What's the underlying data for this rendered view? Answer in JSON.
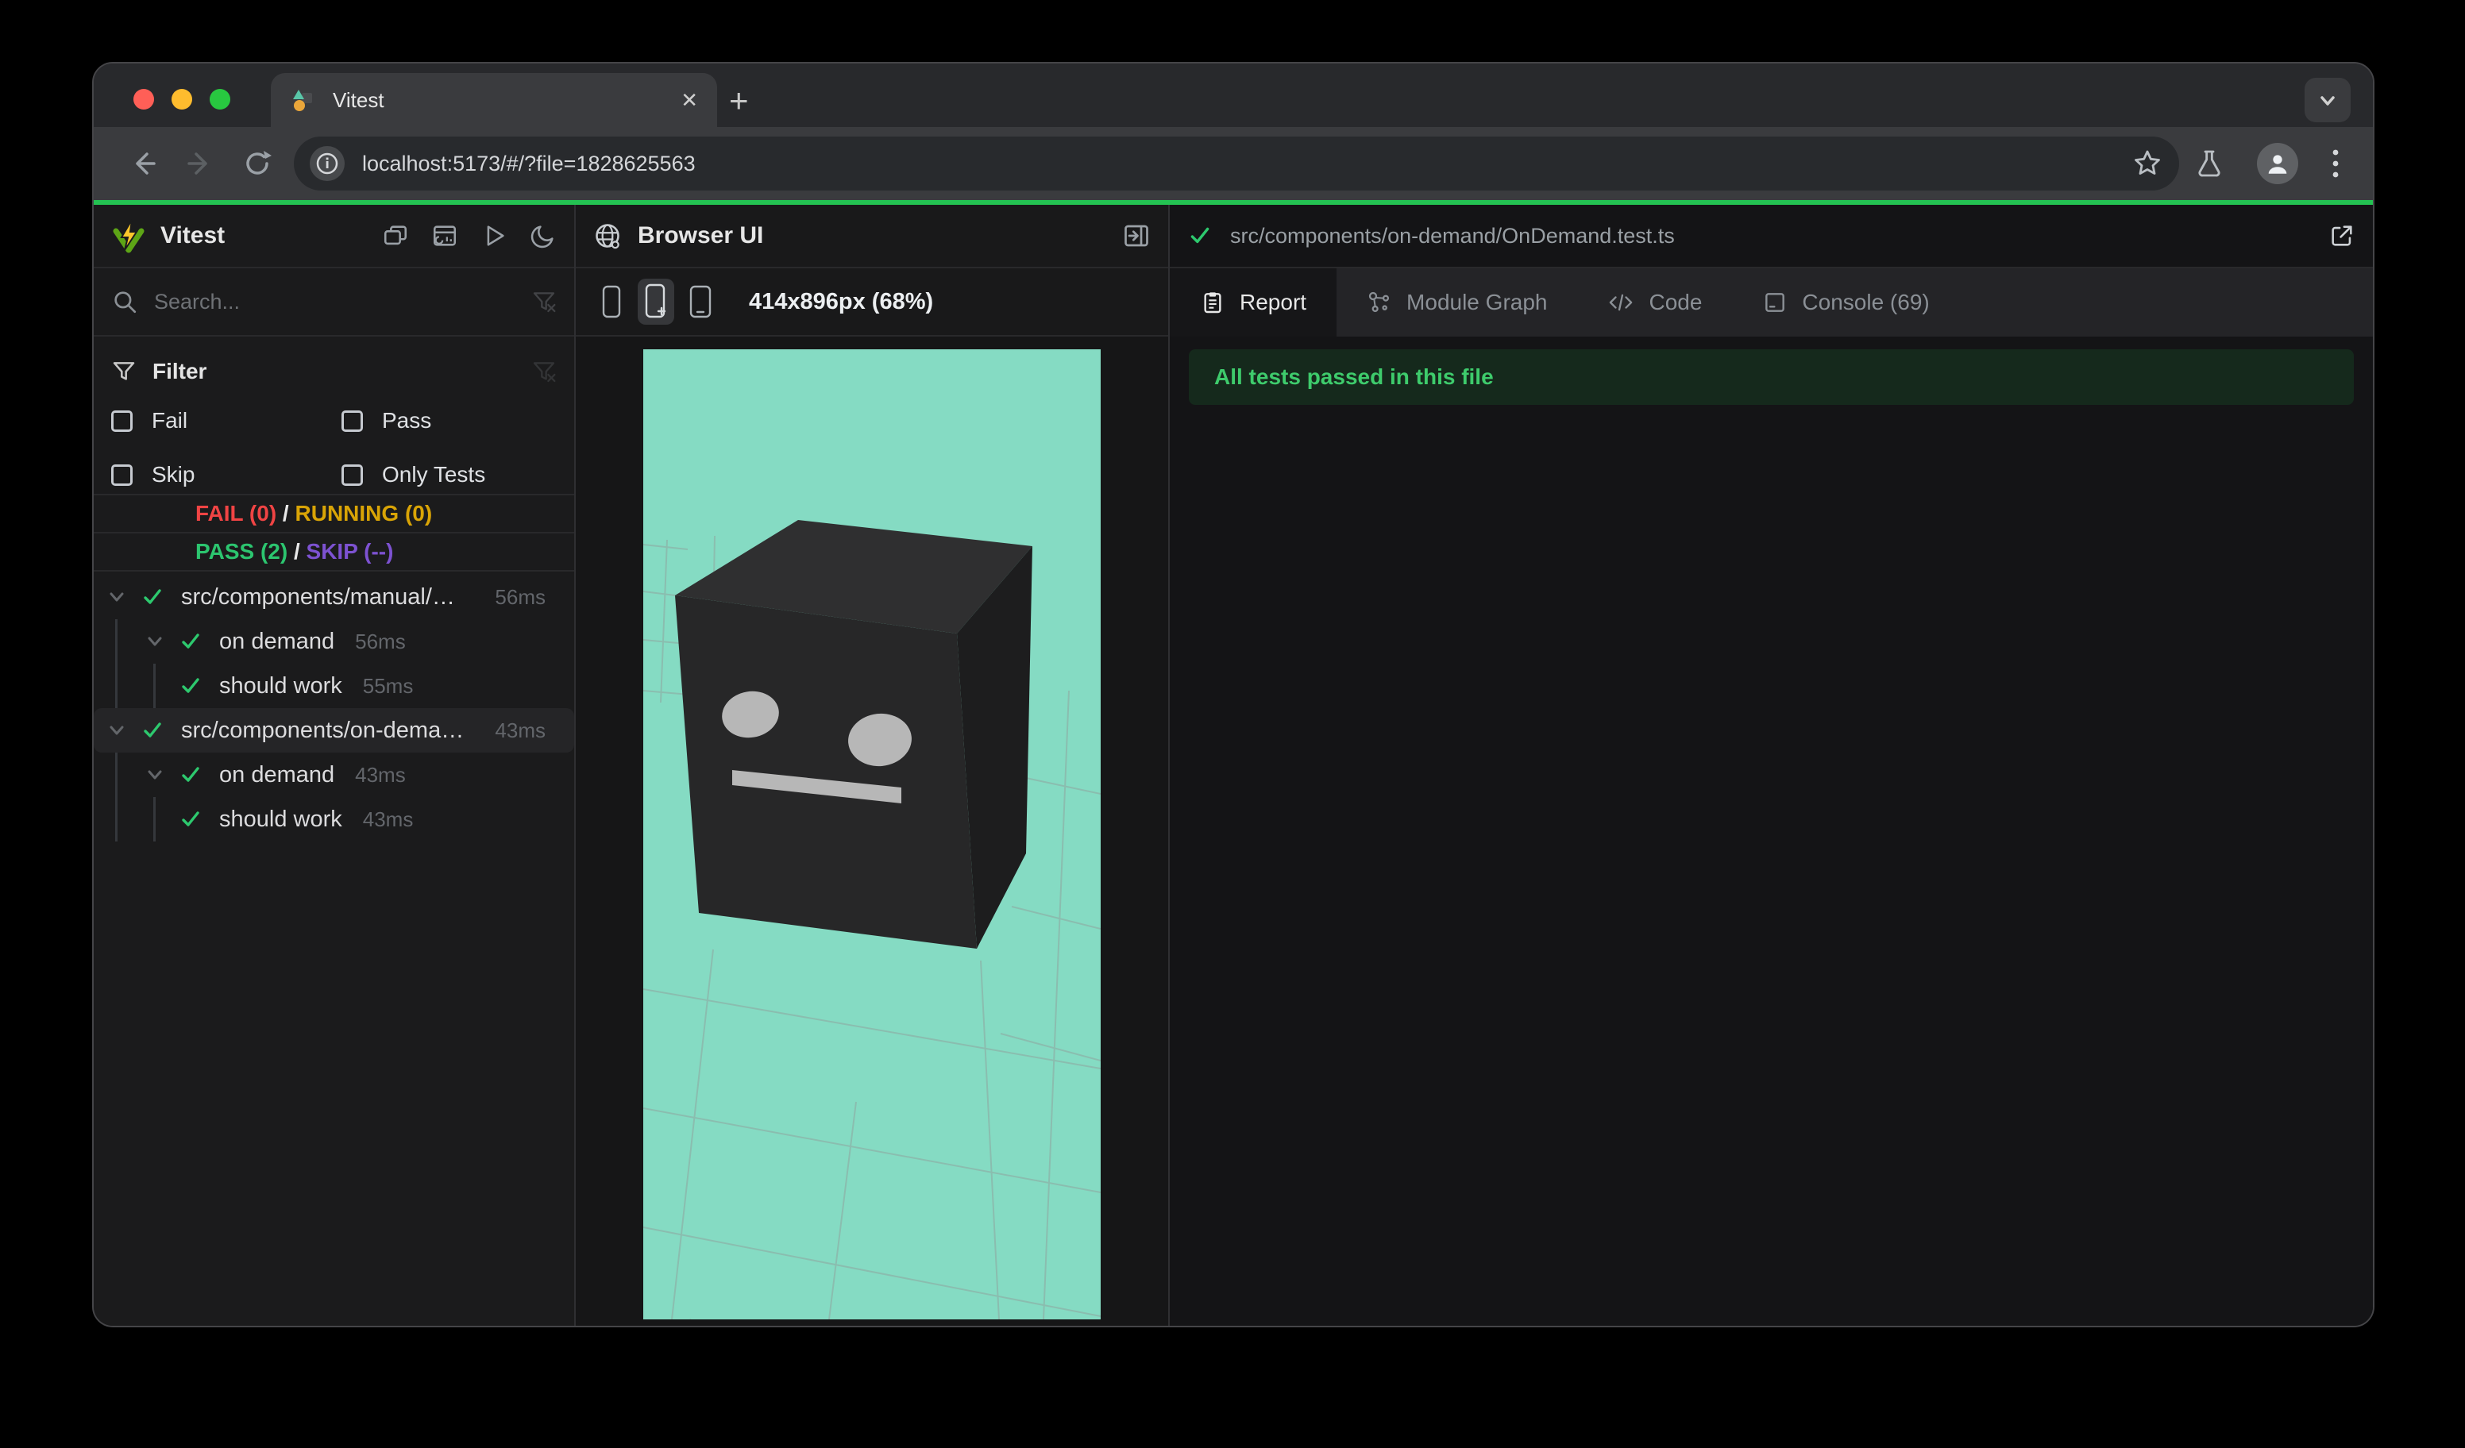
{
  "browser": {
    "tab_title": "Vitest",
    "close_glyph": "✕",
    "new_tab_glyph": "+",
    "url": "localhost:5173/#/?file=1828625563"
  },
  "sidebar": {
    "app_title": "Vitest",
    "search_placeholder": "Search...",
    "filter": {
      "title": "Filter",
      "options": [
        {
          "label": "Fail",
          "checked": false
        },
        {
          "label": "Pass",
          "checked": false
        },
        {
          "label": "Skip",
          "checked": false
        },
        {
          "label": "Only Tests",
          "checked": false
        }
      ]
    },
    "summary": {
      "fail_label": "FAIL (0)",
      "running_label": "RUNNING (0)",
      "pass_label": "PASS (2)",
      "skip_label": "SKIP (--)",
      "separator": " / "
    },
    "tree": {
      "rows": [
        {
          "name": "src/components/manual/…",
          "duration": "56ms",
          "level": 0,
          "selected": false
        },
        {
          "name": "on demand",
          "duration": "56ms",
          "level": 1,
          "selected": false
        },
        {
          "name": "should work",
          "duration": "55ms",
          "level": 2,
          "selected": false
        },
        {
          "name": "src/components/on-dema…",
          "duration": "43ms",
          "level": 0,
          "selected": true
        },
        {
          "name": "on demand",
          "duration": "43ms",
          "level": 1,
          "selected": false
        },
        {
          "name": "should work",
          "duration": "43ms",
          "level": 2,
          "selected": false
        }
      ]
    }
  },
  "preview": {
    "panel_title": "Browser UI",
    "resolution": "414x896px (68%)"
  },
  "report": {
    "file_path": "src/components/on-demand/OnDemand.test.ts",
    "tabs": [
      {
        "label": "Report",
        "active": true
      },
      {
        "label": "Module Graph",
        "active": false
      },
      {
        "label": "Code",
        "active": false
      },
      {
        "label": "Console (69)",
        "active": false
      }
    ],
    "banner": "All tests passed in this file"
  },
  "colors": {
    "fail": "#f04444",
    "running": "#d9a406",
    "pass": "#2cc56f",
    "skip": "#7d52d1",
    "check_green": "#2dc96e",
    "progress_green": "#24c252",
    "banner_bg": "#15291c",
    "banner_text": "#3ecb6c",
    "viewport_bg": "#85dbc3",
    "traffic_red": "#ff5f57",
    "traffic_yellow": "#febc2e",
    "traffic_green": "#28c840"
  }
}
